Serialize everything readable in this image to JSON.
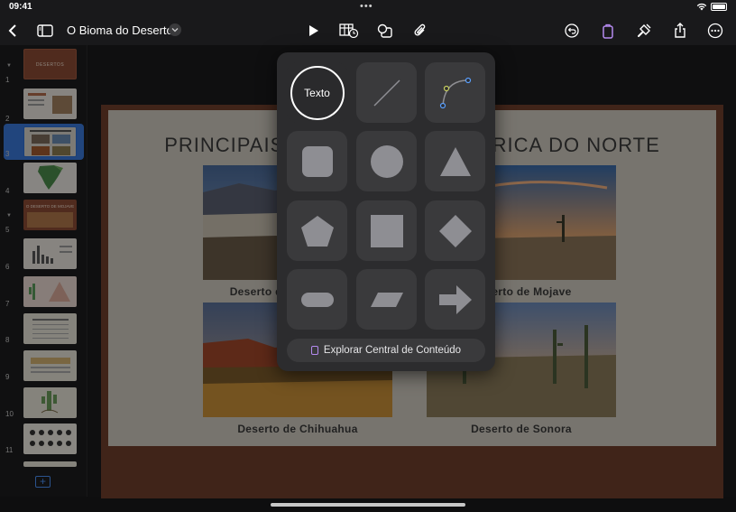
{
  "status": {
    "time": "09:41"
  },
  "toolbar": {
    "doc_title": "O Bioma do Deserto"
  },
  "slide": {
    "title": "PRINCIPAIS DESERTOS DA AMÉRICA DO NORTE",
    "captions": [
      "Deserto do Vale da Morte",
      "Deserto de Mojave",
      "Deserto de Chihuahua",
      "Deserto de Sonora"
    ]
  },
  "navigator": {
    "slides": [
      "1",
      "2",
      "3",
      "4",
      "5",
      "6",
      "7",
      "8",
      "9",
      "10",
      "11"
    ],
    "slide1_label": "DESERTOS",
    "slide5_label": "O DESERTO DE MOJAVE",
    "selected": "3"
  },
  "popover": {
    "text_label": "Texto",
    "explore_label": "Explorar Central de Conteúdo"
  },
  "colors": {
    "accent": "#b58af0",
    "selection": "#3a78d8"
  }
}
